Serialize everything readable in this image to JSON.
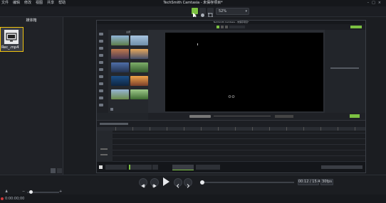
{
  "app": {
    "window_title": "TechSmith Camtasia - 未保存项目*",
    "menu": [
      "文件",
      "编辑",
      "修改",
      "视图",
      "共享",
      "帮助"
    ]
  },
  "toolbar": {
    "zoom_value": "52%"
  },
  "media_bin": {
    "title": "媒体箱",
    "items": [
      {
        "filename": "Rec_.mp4"
      }
    ]
  },
  "transport": {
    "time_current": "00:12",
    "time_total": "15:41",
    "fps": "30fps"
  },
  "status": {
    "timecode": "0:00:00;00"
  },
  "inner_screenshot": {
    "title": "TechSmith Camtasia - 未保存项目*",
    "panel_title": "主题"
  },
  "colors": {
    "accent": "#7cc142",
    "background": "#1f2126",
    "preview_black": "#000000"
  }
}
